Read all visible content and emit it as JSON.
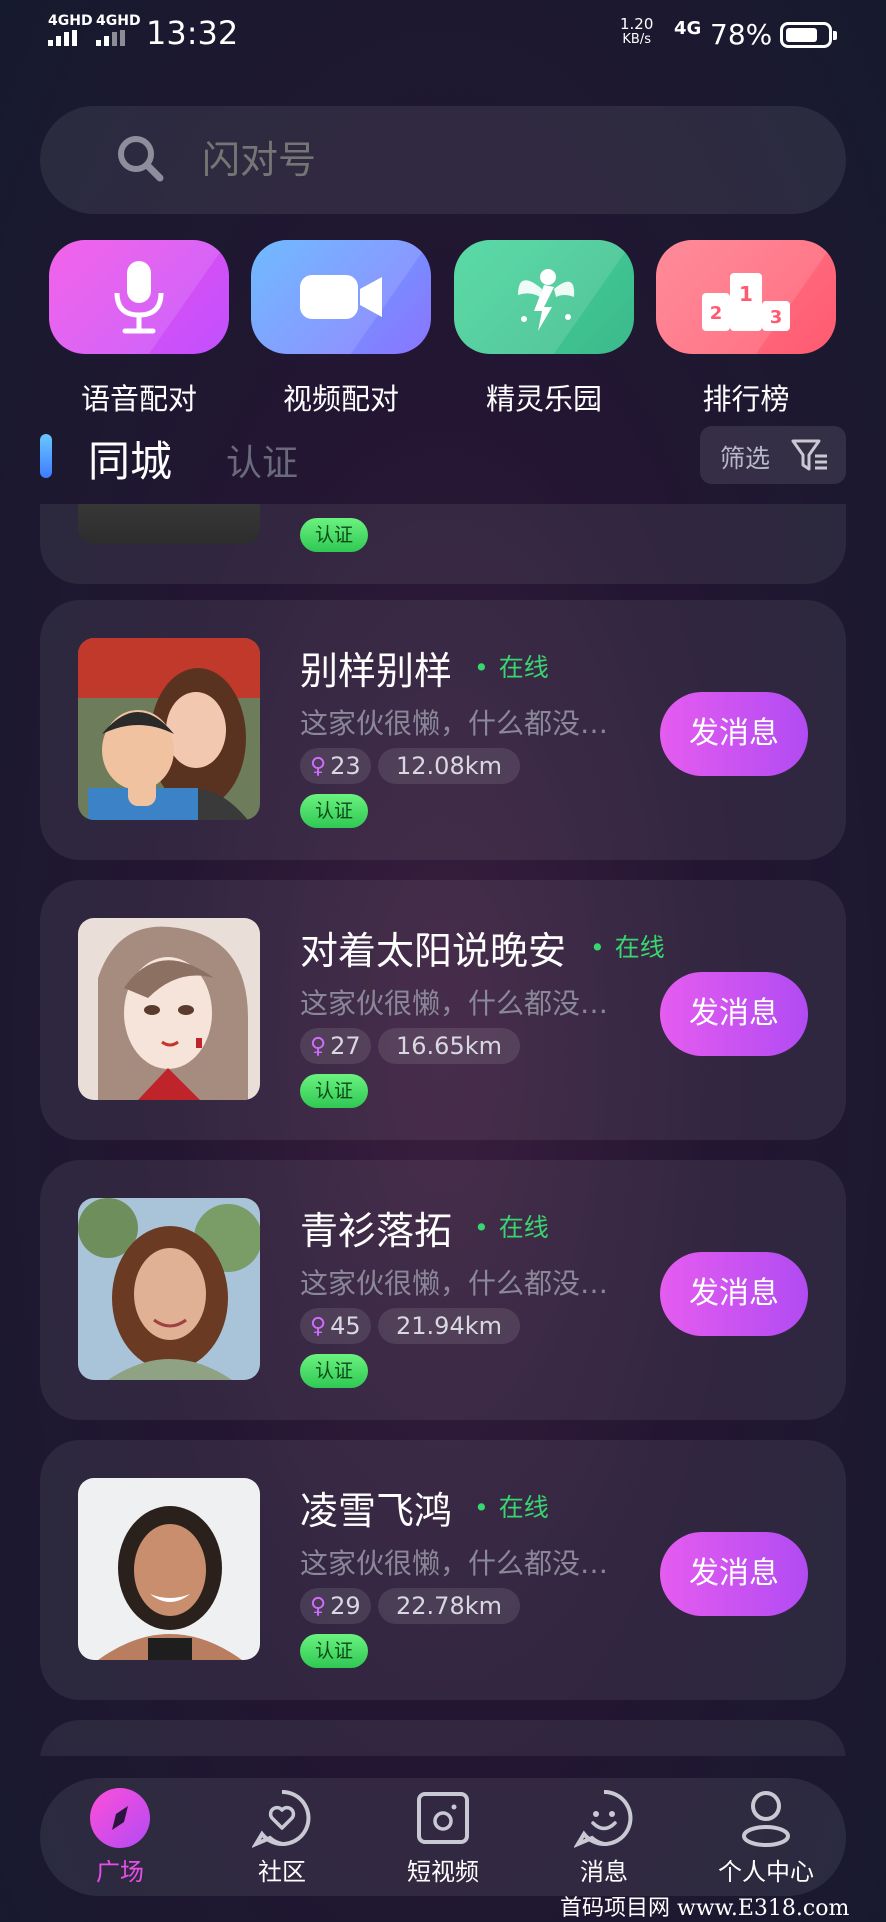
{
  "status_bar": {
    "network_1": "4GHD",
    "network_2": "4GHD",
    "time": "13:32",
    "speed_value": "1.20",
    "speed_unit": "KB/s",
    "network_type": "4G",
    "battery_percent": "78%",
    "battery_level": 0.78
  },
  "search": {
    "placeholder": "闪对号",
    "icon": "search-icon"
  },
  "features": [
    {
      "label": "语音配对",
      "icon": "microphone-icon",
      "color_from": "#f14ee6",
      "color_to": "#c150ff"
    },
    {
      "label": "视频配对",
      "icon": "video-camera-icon",
      "color_from": "#5bb2ff",
      "color_to": "#8b74ff"
    },
    {
      "label": "精灵乐园",
      "icon": "fairy-icon",
      "color_from": "#44d69a",
      "color_to": "#3cb98c"
    },
    {
      "label": "排行榜",
      "icon": "podium-icon",
      "color_from": "#ff7c8c",
      "color_to": "#ff5a70"
    }
  ],
  "section": {
    "active_tab": "同城",
    "inactive_tab": "认证",
    "filter_label": "筛选"
  },
  "partial_card": {
    "badge": "认证"
  },
  "users": [
    {
      "name": "别样别样",
      "status": "在线",
      "bio": "这家伙很懒，什么都没…",
      "age": "23",
      "distance": "12.08km",
      "badge": "认证",
      "action": "发消息"
    },
    {
      "name": "对着太阳说晚安",
      "status": "在线",
      "bio": "这家伙很懒，什么都没…",
      "age": "27",
      "distance": "16.65km",
      "badge": "认证",
      "action": "发消息"
    },
    {
      "name": "青衫落拓",
      "status": "在线",
      "bio": "这家伙很懒，什么都没…",
      "age": "45",
      "distance": "21.94km",
      "badge": "认证",
      "action": "发消息"
    },
    {
      "name": "凌雪飞鸿",
      "status": "在线",
      "bio": "这家伙很懒，什么都没…",
      "age": "29",
      "distance": "22.78km",
      "badge": "认证",
      "action": "发消息"
    }
  ],
  "nav": [
    {
      "label": "广场",
      "icon": "compass-icon",
      "active": true
    },
    {
      "label": "社区",
      "icon": "heart-chat-icon",
      "active": false
    },
    {
      "label": "短视频",
      "icon": "short-video-icon",
      "active": false
    },
    {
      "label": "消息",
      "icon": "smile-message-icon",
      "active": false
    },
    {
      "label": "个人中心",
      "icon": "person-icon",
      "active": false
    }
  ],
  "watermark": "首码项目网 www.E318.com"
}
